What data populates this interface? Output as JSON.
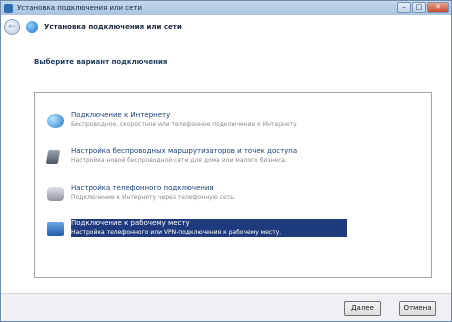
{
  "window": {
    "title": "Установка подключения или сети",
    "buttons": {
      "minimize": "–",
      "maximize": "□",
      "close": "✕"
    }
  },
  "nav": {
    "back_symbol": "←",
    "title": "Установка подключения или сети"
  },
  "content": {
    "heading": "Выберите вариант подключения",
    "options": [
      {
        "title": "Подключение к Интернету",
        "description": "Беспроводное, скоростное или телефонное подключение к Интернету.",
        "icon": "globe-icon",
        "selected": false
      },
      {
        "title": "Настройка беспроводных маршрутизаторов и точек доступа",
        "description": "Настройка новой беспроводной сети для дома или малого бизнеса.",
        "icon": "wireless-router-icon",
        "selected": false
      },
      {
        "title": "Настройка телефонного подключения",
        "description": "Подключение к Интернету через телефонную сеть.",
        "icon": "phone-modem-icon",
        "selected": false
      },
      {
        "title": "Подключение к рабочему месту",
        "description": "Настройка телефонного или VPN-подключения к рабочему месту.",
        "icon": "workplace-icon",
        "selected": true
      }
    ]
  },
  "footer": {
    "next_label": "Далее",
    "cancel_label": "Отмена"
  },
  "colors": {
    "selection": "#1f3a7d",
    "option_title": "#1a3d7c",
    "option_description": "#8a8a8a"
  }
}
